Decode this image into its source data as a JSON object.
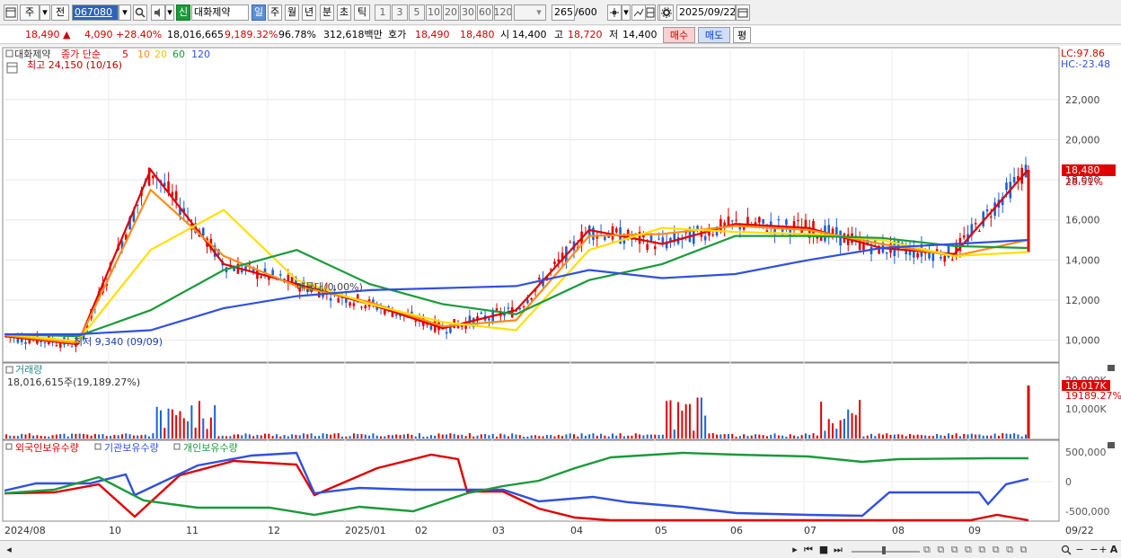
{
  "toolbar": {
    "market": "주",
    "period_type": "전",
    "code": "067080",
    "badge": "신",
    "name": "대화제약",
    "periods": [
      "일",
      "주",
      "월",
      "년",
      "분",
      "초",
      "틱"
    ],
    "active_period": "일",
    "intervals": [
      "1",
      "3",
      "5",
      "10",
      "20",
      "30",
      "60",
      "120"
    ],
    "count": "265",
    "count_max": "/600",
    "date": "2025/09/22"
  },
  "quote": {
    "price": "18,490",
    "arrow": "▲",
    "change": "4,090",
    "change_pct": "+28.40%",
    "volume": "18,016,665",
    "volume_pct": "9,189.32%",
    "ratio": "96.78%",
    "amount": "312,618백만",
    "bid_label": "호가",
    "bid1": "18,490",
    "bid2": "18,480",
    "open_label": "시",
    "open": "14,400",
    "high_label": "고",
    "high": "18,720",
    "low_label": "저",
    "low": "14,400",
    "buy": "매수",
    "sell": "매도",
    "eval": "평"
  },
  "legend": {
    "stock": "대화제약",
    "ma_prefix": "종가 단순",
    "ma": [
      "5",
      "10",
      "20",
      "60",
      "120"
    ],
    "high_note": "최고 24,150 (10/16)",
    "low_note": "최저 9,340 (09/09)",
    "lc": "LC:97.86",
    "hc": "HC:-23.48",
    "price_tag": "18,480",
    "price_pct": "28.51%",
    "tooltip": "매물대(0.00%)"
  },
  "volume_panel": {
    "title": "거래량",
    "value": "18,016,615주(19,189.27%)",
    "tag": "18,017K",
    "tag2": "19189.27%",
    "ticks": [
      "20,000K",
      "10,000K"
    ]
  },
  "holdings_panel": {
    "series": [
      "외국인보유수량",
      "기관보유수량",
      "개인보유수량"
    ],
    "ticks": [
      "500,000",
      "0",
      "-500,000"
    ]
  },
  "x_axis": [
    "2024/08",
    "10",
    "11",
    "12",
    "2025/01",
    "02",
    "03",
    "04",
    "05",
    "06",
    "07",
    "08",
    "09",
    "09/22"
  ],
  "colors": {
    "up": "#e00000",
    "down": "#1f5fd0",
    "ma5": "#e00000",
    "ma10": "#ff8c1a",
    "ma20": "#ffe000",
    "ma60": "#1a9a3a",
    "ma120": "#3050e0"
  },
  "chart_data": {
    "type": "line",
    "title": "대화제약",
    "ylim": [
      9000,
      24500
    ],
    "y_ticks": [
      10000,
      12000,
      14000,
      16000,
      18000,
      20000,
      22000
    ],
    "months": [
      "2024/08",
      "09",
      "10",
      "11",
      "12",
      "2025/01",
      "02",
      "03",
      "04",
      "05",
      "06",
      "07",
      "08",
      "09"
    ],
    "series": [
      {
        "name": "5",
        "values": [
          10200,
          9800,
          18500,
          13800,
          12800,
          11800,
          10600,
          11500,
          15500,
          14800,
          15800,
          15600,
          14600,
          14300,
          18480
        ]
      },
      {
        "name": "10",
        "values": [
          10250,
          9850,
          17500,
          14200,
          12700,
          11900,
          10700,
          11000,
          15200,
          15300,
          15700,
          15500,
          14800,
          14200,
          15000
        ]
      },
      {
        "name": "20",
        "values": [
          10300,
          9950,
          14500,
          16500,
          13000,
          11800,
          10900,
          10500,
          14500,
          15600,
          15400,
          15300,
          15000,
          14200,
          14400
        ]
      },
      {
        "name": "60",
        "values": [
          10300,
          10200,
          11500,
          13500,
          14500,
          12800,
          11800,
          11300,
          13000,
          13800,
          15200,
          15200,
          15100,
          14700,
          14600
        ]
      },
      {
        "name": "120",
        "values": [
          10300,
          10300,
          10500,
          11600,
          12200,
          12500,
          12600,
          12700,
          13500,
          13100,
          13300,
          14000,
          14600,
          14800,
          15000
        ]
      }
    ],
    "high_annotation": {
      "value": 24150,
      "date": "10/16"
    },
    "low_annotation": {
      "value": 9340,
      "date": "09/09"
    },
    "last_price": 18480
  }
}
